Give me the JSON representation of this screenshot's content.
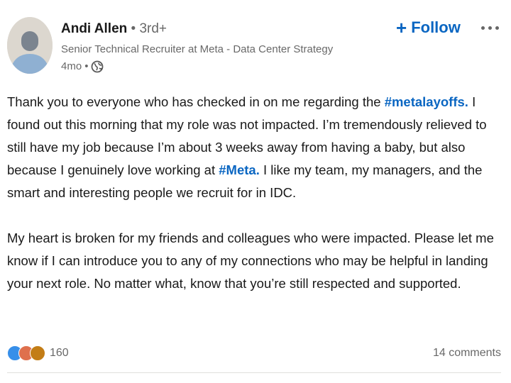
{
  "author": {
    "name": "Andi Allen",
    "separator": "•",
    "degree": "3rd+",
    "headline": "Senior Technical Recruiter at Meta - Data Center Strategy",
    "time": "4mo",
    "time_separator": "•",
    "visibility_icon": "globe-icon"
  },
  "actions": {
    "follow_plus": "+",
    "follow_label": "Follow",
    "more_icon": "more-horizontal-icon"
  },
  "post": {
    "p1_a": "Thank you to everyone who has checked in on me regarding the ",
    "p1_tag1": "#metalayoffs.",
    "p1_b": " I found out this morning that my role was not impacted. I’m tremendously relieved to still have my job because I’m about 3 weeks away from having a baby, but also because I genuinely love working at ",
    "p1_tag2": "#Meta.",
    "p1_c": " I like my team, my managers, and the smart and interesting people we recruit for in IDC.",
    "p2": "My heart is broken for my friends and colleagues who were impacted. Please let me know if I can introduce you to any of my connections who may be helpful in landing your next role. No matter what, know that you’re still respected and supported."
  },
  "social": {
    "reaction_icons": [
      "like-icon",
      "love-icon",
      "insightful-icon"
    ],
    "reaction_count": "160",
    "comments": "14 comments"
  },
  "colors": {
    "link_blue": "#0a66c2",
    "muted_text": "rgba(0,0,0,0.6)"
  }
}
